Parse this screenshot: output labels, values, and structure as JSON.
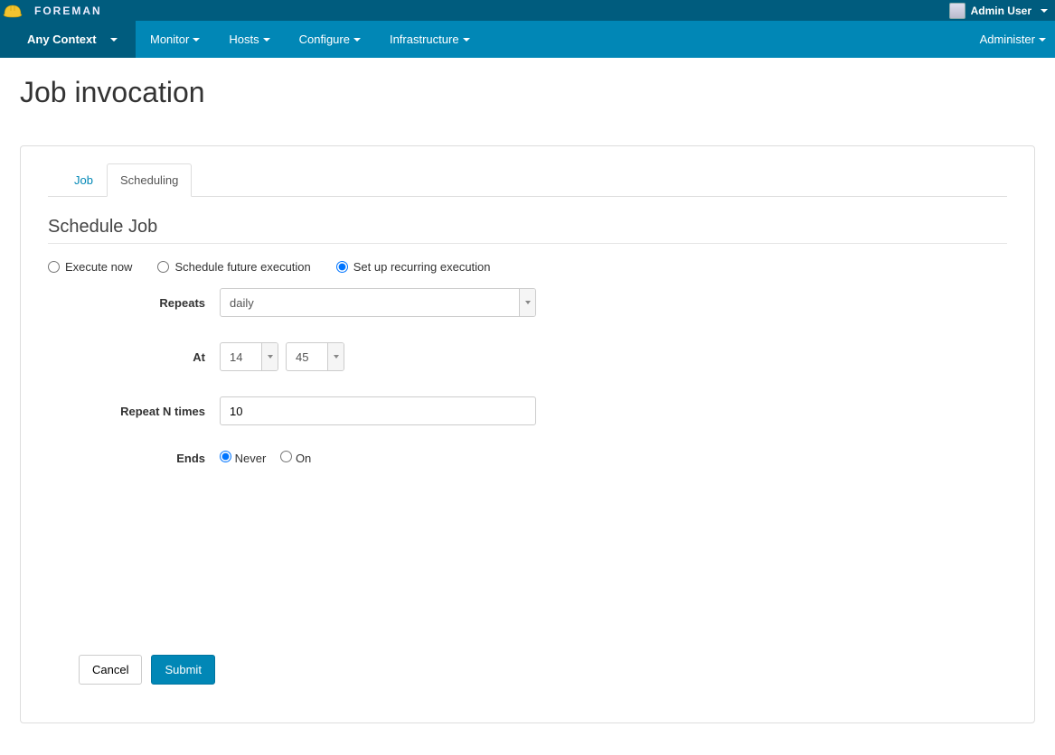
{
  "header": {
    "brand": "FOREMAN",
    "user_name": "Admin User"
  },
  "nav": {
    "context": "Any Context",
    "items": [
      "Monitor",
      "Hosts",
      "Configure",
      "Infrastructure"
    ],
    "admin": "Administer"
  },
  "page": {
    "title": "Job invocation"
  },
  "tabs": {
    "job": "Job",
    "scheduling": "Scheduling",
    "active": "scheduling"
  },
  "section": {
    "title": "Schedule Job"
  },
  "schedule_mode": {
    "execute_now": "Execute now",
    "schedule_future": "Schedule future execution",
    "recurring": "Set up recurring execution",
    "selected": "recurring"
  },
  "form": {
    "repeats_label": "Repeats",
    "repeats_value": "daily",
    "at_label": "At",
    "at_hour": "14",
    "at_minute": "45",
    "repeat_n_label": "Repeat N times",
    "repeat_n_value": "10",
    "ends_label": "Ends",
    "ends_never": "Never",
    "ends_on": "On",
    "ends_selected": "never"
  },
  "actions": {
    "cancel": "Cancel",
    "submit": "Submit"
  }
}
